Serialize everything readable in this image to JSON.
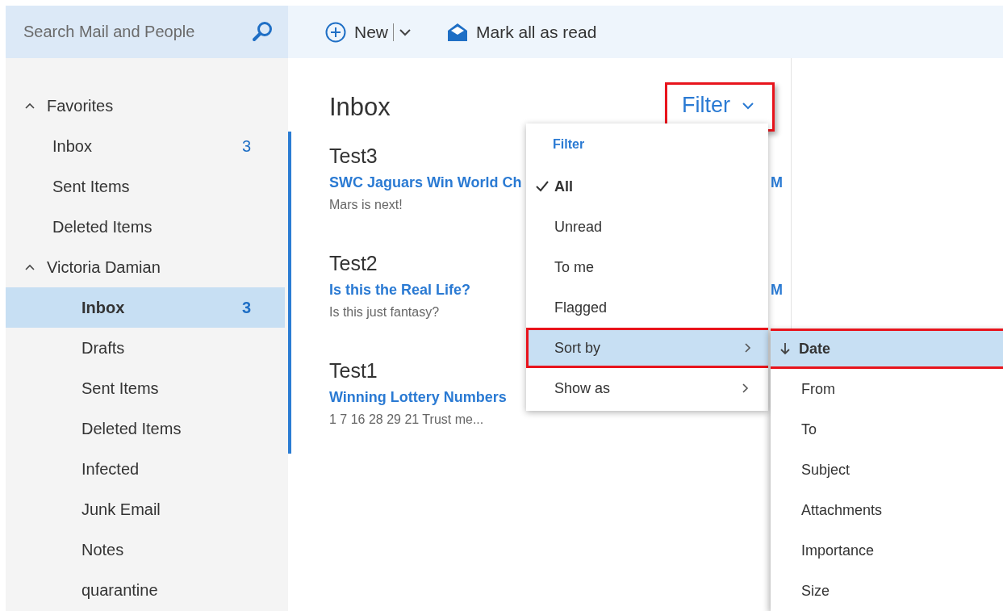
{
  "search": {
    "placeholder": "Search Mail and People"
  },
  "toolbar": [
    {
      "kind": "new",
      "label": "New"
    },
    {
      "kind": "mark-read",
      "label": "Mark all as read"
    }
  ],
  "folders": [
    {
      "label": "Favorites",
      "kind": "favorites",
      "expanded": true,
      "children": [
        {
          "label": "Inbox",
          "count": "3",
          "selected": false
        },
        {
          "label": "Sent Items",
          "selected": false
        },
        {
          "label": "Deleted Items",
          "selected": false
        }
      ]
    },
    {
      "label": "Victoria Damian",
      "kind": "account",
      "expanded": true,
      "children": [
        {
          "label": "Inbox",
          "count": "3",
          "selected": true
        },
        {
          "label": "Drafts",
          "selected": false
        },
        {
          "label": "Sent Items",
          "selected": false
        },
        {
          "label": "Deleted Items",
          "selected": false
        },
        {
          "label": "Infected",
          "selected": false
        },
        {
          "label": "Junk Email",
          "selected": false
        },
        {
          "label": "Notes",
          "selected": false
        },
        {
          "label": "quarantine",
          "selected": false
        }
      ]
    }
  ],
  "list": {
    "title": "Inbox",
    "filter_button": {
      "label": "Filter",
      "highlighted": true
    }
  },
  "messages": [
    {
      "sender": "Test3",
      "subject": "SWC Jaguars Win World Ch",
      "preview": "Mars is next!",
      "time": "M",
      "unread": true
    },
    {
      "sender": "Test2",
      "subject": "Is this the Real Life?",
      "preview": "Is this just fantasy?",
      "time": "M",
      "unread": true
    },
    {
      "sender": "Test1",
      "subject": "Winning Lottery Numbers",
      "preview": "1 7 16 28 29 21 Trust me...",
      "unread": true
    }
  ],
  "filter_menu": {
    "header": "Filter",
    "items": [
      {
        "label": "All",
        "kind": "option",
        "selected": true,
        "highlighted": false
      },
      {
        "label": "Unread",
        "kind": "option",
        "selected": false,
        "highlighted": false
      },
      {
        "label": "To me",
        "kind": "option",
        "selected": false,
        "highlighted": false
      },
      {
        "label": "Flagged",
        "kind": "option",
        "selected": false,
        "highlighted": false
      },
      {
        "label": "Sort by",
        "kind": "submenu",
        "selected": true,
        "highlighted": true
      },
      {
        "label": "Show as",
        "kind": "submenu",
        "selected": false,
        "highlighted": false
      }
    ]
  },
  "sort_menu": {
    "items": [
      {
        "label": "Date",
        "selected": true,
        "highlighted": true
      },
      {
        "label": "From",
        "selected": false,
        "highlighted": false
      },
      {
        "label": "To",
        "selected": false,
        "highlighted": false
      },
      {
        "label": "Subject",
        "selected": false,
        "highlighted": false
      },
      {
        "label": "Attachments",
        "selected": false,
        "highlighted": false
      },
      {
        "label": "Importance",
        "selected": false,
        "highlighted": false
      },
      {
        "label": "Size",
        "selected": false,
        "highlighted": false
      }
    ]
  }
}
